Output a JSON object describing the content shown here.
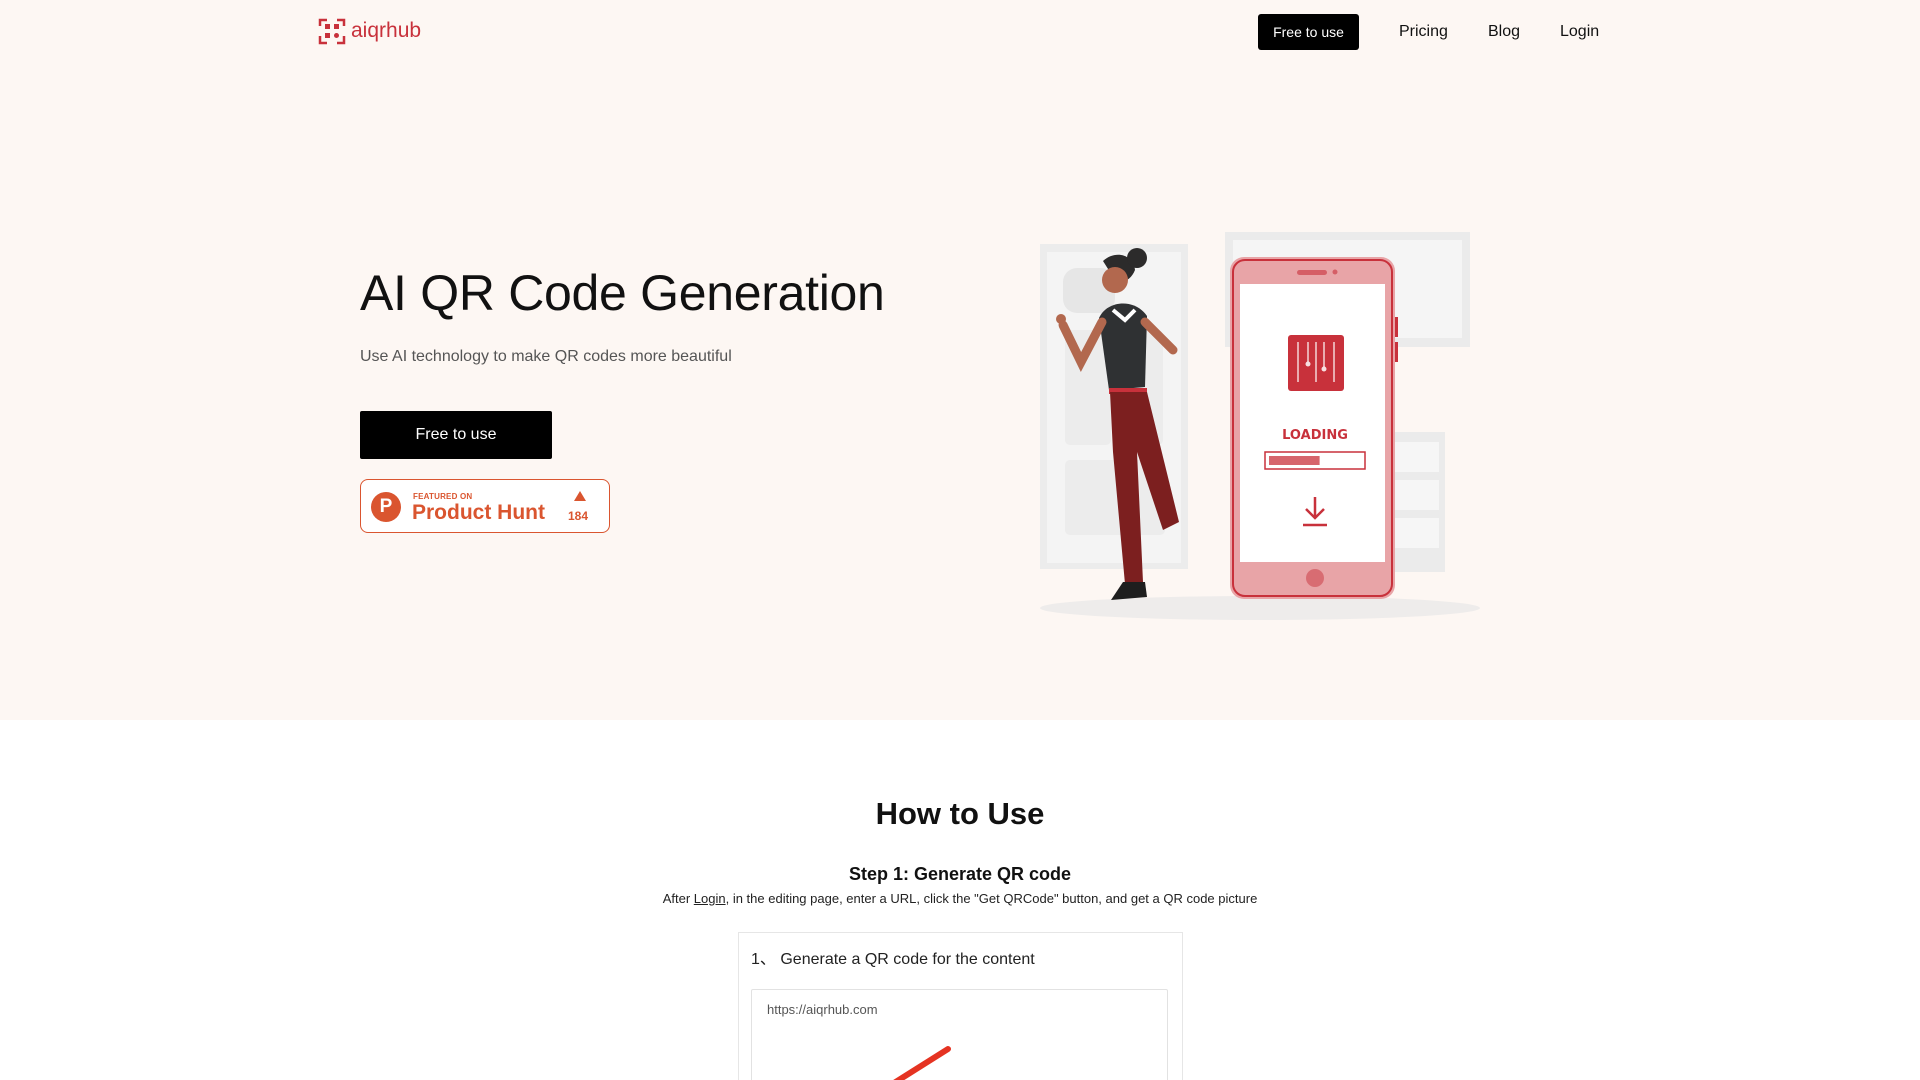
{
  "header": {
    "logo_text": "aiqrhub",
    "nav_cta": "Free to use",
    "nav_links": [
      "Pricing",
      "Blog",
      "Login"
    ]
  },
  "hero": {
    "title": "AI QR Code Generation",
    "subtitle": "Use AI technology to make QR codes more beautiful",
    "cta": "Free to use",
    "product_hunt": {
      "featured": "FEATURED ON",
      "name": "Product Hunt",
      "votes": "184"
    },
    "illustration": {
      "loading_text": "LOADING",
      "loading_progress": 0.55
    }
  },
  "how_to_use": {
    "title": "How to Use",
    "step1_title": "Step 1: Generate QR code",
    "step1_desc_before": "After ",
    "step1_desc_link": "Login",
    "step1_desc_after": ", in the editing page, enter a URL, click the \"Get QRCode\" button, and get a QR code picture",
    "card_title": "1、 Generate a QR code for the content",
    "card_input_value": "https://aiqrhub.com"
  },
  "colors": {
    "brand": "#c8313b",
    "hero_bg": "#fdf7f3",
    "product_hunt": "#da552f"
  }
}
